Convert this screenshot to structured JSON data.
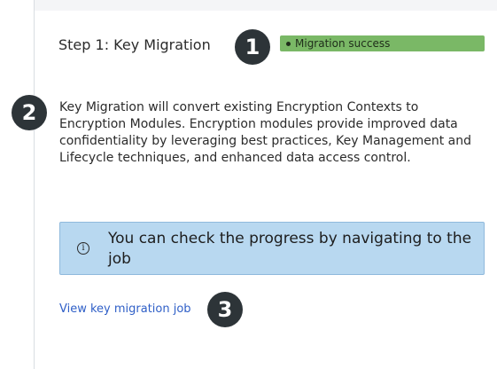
{
  "step": {
    "title": "Step 1: Key Migration"
  },
  "status": {
    "label": "Migration success",
    "color": "#7ab866"
  },
  "description": "Key Migration will convert existing Encryption Contexts to Encryption Modules. Encryption modules provide improved data confidentiality by leveraging best practices, Key Management and Lifecycle techniques, and enhanced data access control.",
  "info": {
    "icon": "info-icon",
    "message": "You can check the progress by navigating to the job"
  },
  "link": {
    "label": "View key migration job"
  },
  "callouts": [
    "1",
    "2",
    "3"
  ]
}
